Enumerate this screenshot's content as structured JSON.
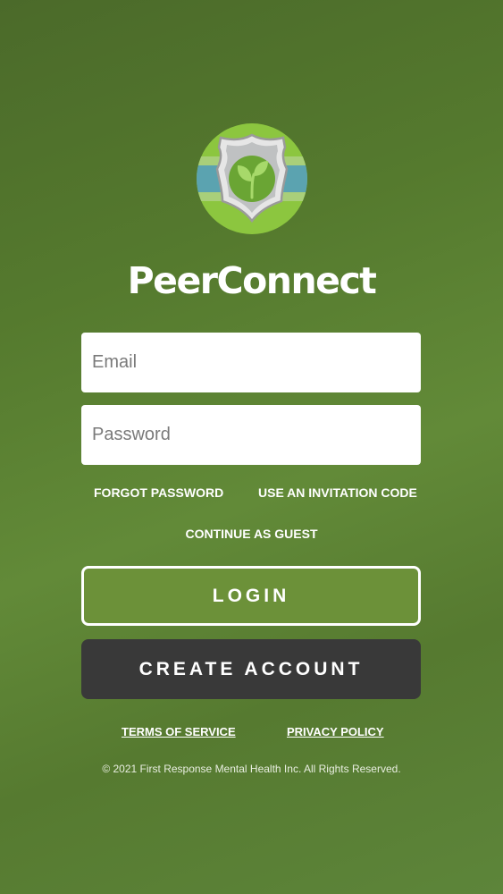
{
  "app": {
    "name": "PeerConnect",
    "logo_icon": "shield-sprout-logo"
  },
  "form": {
    "email_placeholder": "Email",
    "password_placeholder": "Password",
    "email_value": "",
    "password_value": ""
  },
  "links": {
    "forgot_password": "FORGOT PASSWORD",
    "invitation_code": "USE AN INVITATION CODE",
    "continue_guest": "CONTINUE AS GUEST"
  },
  "buttons": {
    "login": "LOGIN",
    "create_account": "CREATE ACCOUNT"
  },
  "footer": {
    "terms": "TERMS OF SERVICE",
    "privacy": "PRIVACY POLICY",
    "copyright": "© 2021 First Response Mental Health Inc. All Rights Reserved."
  },
  "colors": {
    "background": "#557a2e",
    "login_button": "#6c9139",
    "create_button": "#393939",
    "logo_green": "#8cc63f",
    "logo_blue": "#5ba3b0"
  }
}
